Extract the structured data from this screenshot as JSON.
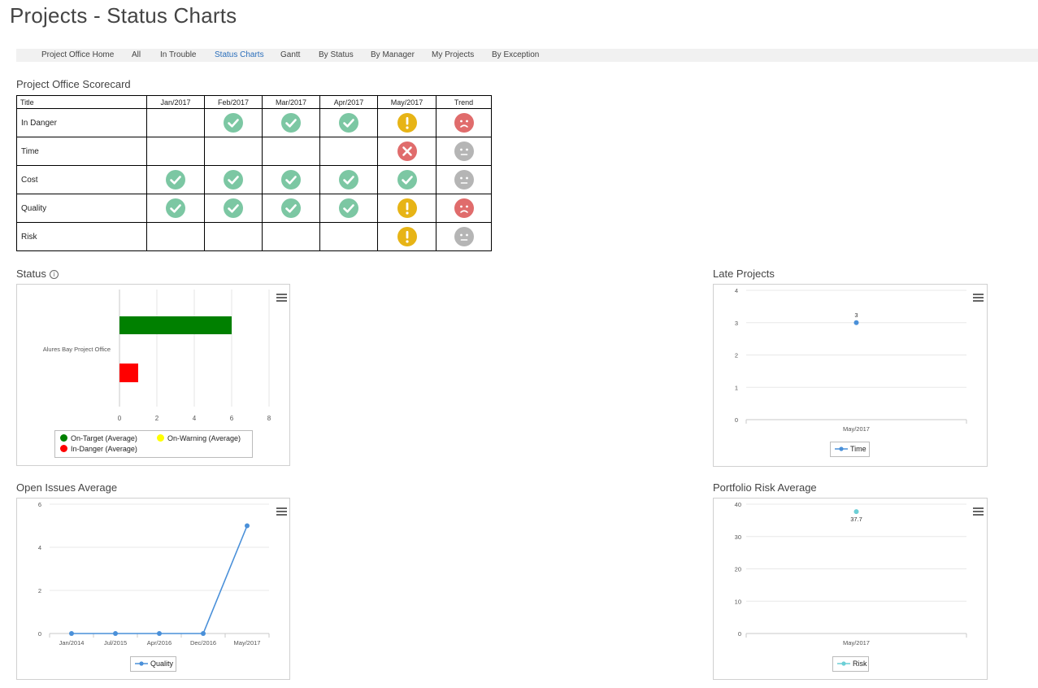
{
  "page_title": "Projects - Status Charts",
  "nav": {
    "items": [
      {
        "label": "Project Office Home",
        "active": false
      },
      {
        "label": "All",
        "active": false
      },
      {
        "label": "In Trouble",
        "active": false
      },
      {
        "label": "Status Charts",
        "active": true
      },
      {
        "label": "Gantt",
        "active": false
      },
      {
        "label": "By Status",
        "active": false
      },
      {
        "label": "By Manager",
        "active": false
      },
      {
        "label": "My Projects",
        "active": false
      },
      {
        "label": "By Exception",
        "active": false
      }
    ]
  },
  "scorecard": {
    "title": "Project Office Scorecard",
    "columns": [
      "Title",
      "Jan/2017",
      "Feb/2017",
      "Mar/2017",
      "Apr/2017",
      "May/2017",
      "Trend"
    ],
    "rows": [
      {
        "label": "In Danger",
        "cells": [
          "",
          "check",
          "check",
          "check",
          "warning",
          "sad-face"
        ]
      },
      {
        "label": "Time",
        "cells": [
          "",
          "",
          "",
          "",
          "cross",
          "neutral-face"
        ]
      },
      {
        "label": "Cost",
        "cells": [
          "check",
          "check",
          "check",
          "check",
          "check",
          "neutral-face"
        ]
      },
      {
        "label": "Quality",
        "cells": [
          "check",
          "check",
          "check",
          "check",
          "warning",
          "sad-face"
        ]
      },
      {
        "label": "Risk",
        "cells": [
          "",
          "",
          "",
          "",
          "warning",
          "neutral-face"
        ]
      }
    ],
    "icon_colors": {
      "check": "#7cc7a3",
      "warning": "#e7b416",
      "cross": "#e06c6c",
      "sad-face": "#e06c6c",
      "neutral-face": "#b5b5b5"
    }
  },
  "charts": {
    "status": {
      "title": "Status",
      "info_icon": "info-icon"
    },
    "late": {
      "title": "Late Projects"
    },
    "issues": {
      "title": "Open Issues Average"
    },
    "risk": {
      "title": "Portfolio Risk Average"
    }
  },
  "chart_data": [
    {
      "id": "status",
      "type": "bar",
      "orientation": "horizontal",
      "categories": [
        "Alures Bay Project Office"
      ],
      "series": [
        {
          "name": "On-Target (Average)",
          "color": "#008000",
          "values": [
            6
          ]
        },
        {
          "name": "On-Warning (Average)",
          "color": "#ffff00",
          "values": [
            0
          ]
        },
        {
          "name": "In-Danger (Average)",
          "color": "#ff0000",
          "values": [
            1
          ]
        }
      ],
      "xlim": [
        0,
        8
      ],
      "xticks": [
        "0",
        "2",
        "4",
        "6",
        "8"
      ],
      "grid": true,
      "legend": "bottom"
    },
    {
      "id": "late",
      "type": "line",
      "categories": [
        "May/2017"
      ],
      "series": [
        {
          "name": "Time",
          "color": "#4a90d9",
          "values": [
            3
          ]
        }
      ],
      "data_labels": [
        "3"
      ],
      "ylim": [
        0,
        4
      ],
      "yticks": [
        "0",
        "1",
        "2",
        "3",
        "4"
      ],
      "grid": true,
      "legend": "bottom"
    },
    {
      "id": "issues",
      "type": "line",
      "categories": [
        "Jan/2014",
        "Jul/2015",
        "Apr/2016",
        "Dec/2016",
        "May/2017"
      ],
      "series": [
        {
          "name": "Quality",
          "color": "#4a90d9",
          "values": [
            0,
            0,
            0,
            0,
            5
          ]
        }
      ],
      "ylim": [
        0,
        6
      ],
      "yticks": [
        "0",
        "2",
        "4",
        "6"
      ],
      "grid": true,
      "legend": "bottom"
    },
    {
      "id": "risk",
      "type": "line",
      "categories": [
        "May/2017"
      ],
      "series": [
        {
          "name": "Risk",
          "color": "#6ccfd6",
          "values": [
            37.7
          ]
        }
      ],
      "data_labels": [
        "37.7"
      ],
      "ylim": [
        0,
        40
      ],
      "yticks": [
        "0",
        "10",
        "20",
        "30",
        "40"
      ],
      "grid": true,
      "legend": "bottom"
    }
  ]
}
